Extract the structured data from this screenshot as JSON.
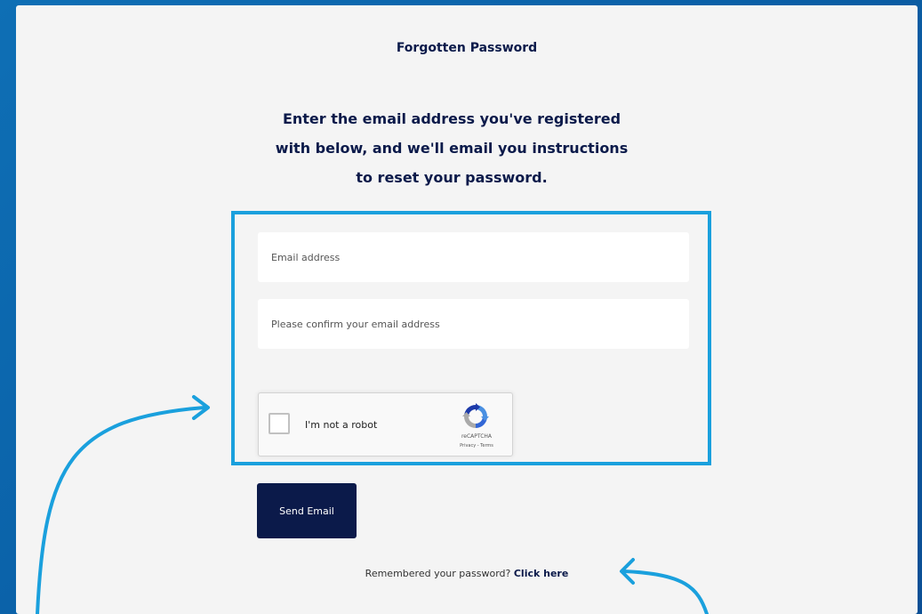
{
  "page": {
    "heading": "Forgotten Password",
    "intro_line1": "Enter the email address you've registered",
    "intro_line2": "with below, and we'll email you instructions",
    "intro_line3": "to reset your password."
  },
  "form": {
    "email_placeholder": "Email address",
    "confirm_placeholder": "Please confirm your email address",
    "send_label": "Send Email"
  },
  "recaptcha": {
    "label": "I'm not a robot",
    "brand": "reCAPTCHA",
    "terms": "Privacy - Terms"
  },
  "footer": {
    "remembered_text": "Remembered your password? ",
    "click_here_label": "Click here"
  },
  "colors": {
    "background": "#0a5fa6",
    "panel": "#f4f4f4",
    "navy": "#0b1a4a",
    "highlight": "#1aa0dd"
  }
}
